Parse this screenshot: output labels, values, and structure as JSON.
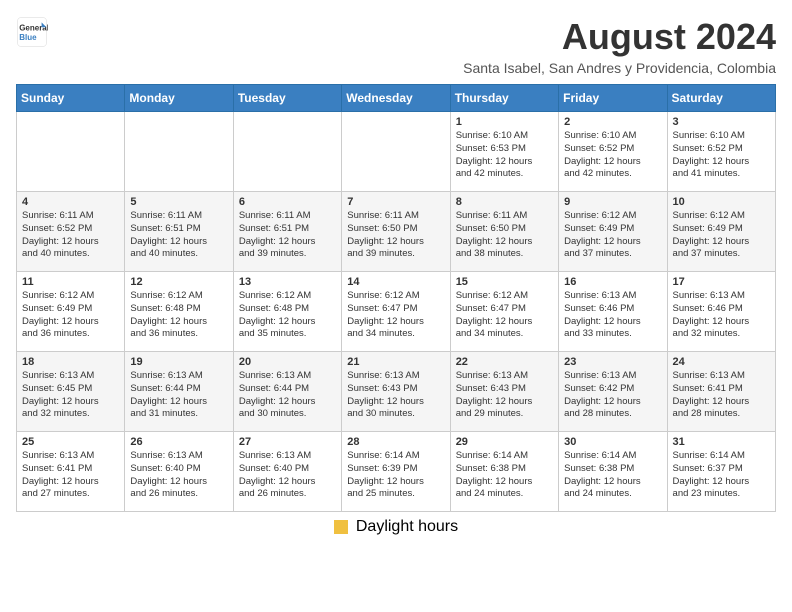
{
  "header": {
    "logo_general": "General",
    "logo_blue": "Blue",
    "main_title": "August 2024",
    "subtitle": "Santa Isabel, San Andres y Providencia, Colombia"
  },
  "calendar": {
    "weekdays": [
      "Sunday",
      "Monday",
      "Tuesday",
      "Wednesday",
      "Thursday",
      "Friday",
      "Saturday"
    ],
    "footer_label": "Daylight hours"
  },
  "weeks": [
    [
      {
        "day": "",
        "info": ""
      },
      {
        "day": "",
        "info": ""
      },
      {
        "day": "",
        "info": ""
      },
      {
        "day": "",
        "info": ""
      },
      {
        "day": "1",
        "info": "Sunrise: 6:10 AM\nSunset: 6:53 PM\nDaylight: 12 hours\nand 42 minutes."
      },
      {
        "day": "2",
        "info": "Sunrise: 6:10 AM\nSunset: 6:52 PM\nDaylight: 12 hours\nand 42 minutes."
      },
      {
        "day": "3",
        "info": "Sunrise: 6:10 AM\nSunset: 6:52 PM\nDaylight: 12 hours\nand 41 minutes."
      }
    ],
    [
      {
        "day": "4",
        "info": "Sunrise: 6:11 AM\nSunset: 6:52 PM\nDaylight: 12 hours\nand 40 minutes."
      },
      {
        "day": "5",
        "info": "Sunrise: 6:11 AM\nSunset: 6:51 PM\nDaylight: 12 hours\nand 40 minutes."
      },
      {
        "day": "6",
        "info": "Sunrise: 6:11 AM\nSunset: 6:51 PM\nDaylight: 12 hours\nand 39 minutes."
      },
      {
        "day": "7",
        "info": "Sunrise: 6:11 AM\nSunset: 6:50 PM\nDaylight: 12 hours\nand 39 minutes."
      },
      {
        "day": "8",
        "info": "Sunrise: 6:11 AM\nSunset: 6:50 PM\nDaylight: 12 hours\nand 38 minutes."
      },
      {
        "day": "9",
        "info": "Sunrise: 6:12 AM\nSunset: 6:49 PM\nDaylight: 12 hours\nand 37 minutes."
      },
      {
        "day": "10",
        "info": "Sunrise: 6:12 AM\nSunset: 6:49 PM\nDaylight: 12 hours\nand 37 minutes."
      }
    ],
    [
      {
        "day": "11",
        "info": "Sunrise: 6:12 AM\nSunset: 6:49 PM\nDaylight: 12 hours\nand 36 minutes."
      },
      {
        "day": "12",
        "info": "Sunrise: 6:12 AM\nSunset: 6:48 PM\nDaylight: 12 hours\nand 36 minutes."
      },
      {
        "day": "13",
        "info": "Sunrise: 6:12 AM\nSunset: 6:48 PM\nDaylight: 12 hours\nand 35 minutes."
      },
      {
        "day": "14",
        "info": "Sunrise: 6:12 AM\nSunset: 6:47 PM\nDaylight: 12 hours\nand 34 minutes."
      },
      {
        "day": "15",
        "info": "Sunrise: 6:12 AM\nSunset: 6:47 PM\nDaylight: 12 hours\nand 34 minutes."
      },
      {
        "day": "16",
        "info": "Sunrise: 6:13 AM\nSunset: 6:46 PM\nDaylight: 12 hours\nand 33 minutes."
      },
      {
        "day": "17",
        "info": "Sunrise: 6:13 AM\nSunset: 6:46 PM\nDaylight: 12 hours\nand 32 minutes."
      }
    ],
    [
      {
        "day": "18",
        "info": "Sunrise: 6:13 AM\nSunset: 6:45 PM\nDaylight: 12 hours\nand 32 minutes."
      },
      {
        "day": "19",
        "info": "Sunrise: 6:13 AM\nSunset: 6:44 PM\nDaylight: 12 hours\nand 31 minutes."
      },
      {
        "day": "20",
        "info": "Sunrise: 6:13 AM\nSunset: 6:44 PM\nDaylight: 12 hours\nand 30 minutes."
      },
      {
        "day": "21",
        "info": "Sunrise: 6:13 AM\nSunset: 6:43 PM\nDaylight: 12 hours\nand 30 minutes."
      },
      {
        "day": "22",
        "info": "Sunrise: 6:13 AM\nSunset: 6:43 PM\nDaylight: 12 hours\nand 29 minutes."
      },
      {
        "day": "23",
        "info": "Sunrise: 6:13 AM\nSunset: 6:42 PM\nDaylight: 12 hours\nand 28 minutes."
      },
      {
        "day": "24",
        "info": "Sunrise: 6:13 AM\nSunset: 6:41 PM\nDaylight: 12 hours\nand 28 minutes."
      }
    ],
    [
      {
        "day": "25",
        "info": "Sunrise: 6:13 AM\nSunset: 6:41 PM\nDaylight: 12 hours\nand 27 minutes."
      },
      {
        "day": "26",
        "info": "Sunrise: 6:13 AM\nSunset: 6:40 PM\nDaylight: 12 hours\nand 26 minutes."
      },
      {
        "day": "27",
        "info": "Sunrise: 6:13 AM\nSunset: 6:40 PM\nDaylight: 12 hours\nand 26 minutes."
      },
      {
        "day": "28",
        "info": "Sunrise: 6:14 AM\nSunset: 6:39 PM\nDaylight: 12 hours\nand 25 minutes."
      },
      {
        "day": "29",
        "info": "Sunrise: 6:14 AM\nSunset: 6:38 PM\nDaylight: 12 hours\nand 24 minutes."
      },
      {
        "day": "30",
        "info": "Sunrise: 6:14 AM\nSunset: 6:38 PM\nDaylight: 12 hours\nand 24 minutes."
      },
      {
        "day": "31",
        "info": "Sunrise: 6:14 AM\nSunset: 6:37 PM\nDaylight: 12 hours\nand 23 minutes."
      }
    ]
  ]
}
